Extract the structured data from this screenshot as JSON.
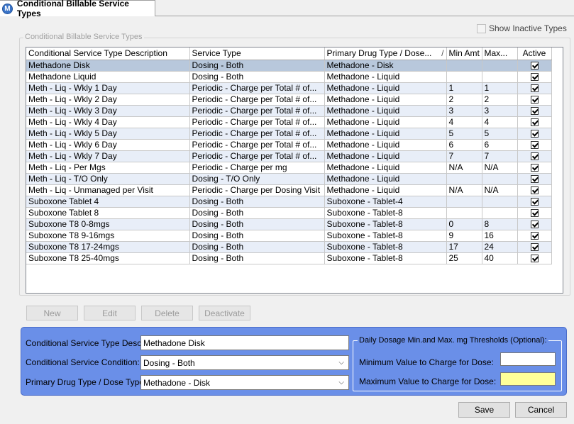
{
  "tab": {
    "icon": "app-logo-icon",
    "icon_glyph": "M",
    "title": "Conditional Billable Service Types"
  },
  "group": {
    "title": "Conditional Billable Service Types"
  },
  "show_inactive": {
    "label": "Show Inactive Types",
    "checked": false
  },
  "grid": {
    "columns": [
      "Conditional Service Type Description",
      "Service Type",
      "Primary Drug Type / Dose...",
      "Min Amt",
      "Max...",
      "Active"
    ],
    "sort_indicator": "/",
    "rows": [
      {
        "desc": "Methadone Disk",
        "service": "Dosing - Both",
        "drug": "Methadone - Disk",
        "min": "",
        "max": "",
        "active": true
      },
      {
        "desc": "Methadone Liquid",
        "service": "Dosing - Both",
        "drug": "Methadone - Liquid",
        "min": "",
        "max": "",
        "active": true
      },
      {
        "desc": "Meth - Liq - Wkly 1 Day",
        "service": "Periodic - Charge per Total # of...",
        "drug": "Methadone - Liquid",
        "min": "1",
        "max": "1",
        "active": true
      },
      {
        "desc": "Meth - Liq - Wkly 2 Day",
        "service": "Periodic - Charge per Total # of...",
        "drug": "Methadone - Liquid",
        "min": "2",
        "max": "2",
        "active": true
      },
      {
        "desc": "Meth - Liq - Wkly 3 Day",
        "service": "Periodic - Charge per Total # of...",
        "drug": "Methadone - Liquid",
        "min": "3",
        "max": "3",
        "active": true
      },
      {
        "desc": "Meth - Liq - Wkly 4 Day",
        "service": "Periodic - Charge per Total # of...",
        "drug": "Methadone - Liquid",
        "min": "4",
        "max": "4",
        "active": true
      },
      {
        "desc": "Meth - Liq - Wkly 5 Day",
        "service": "Periodic - Charge per Total # of...",
        "drug": "Methadone - Liquid",
        "min": "5",
        "max": "5",
        "active": true
      },
      {
        "desc": "Meth - Liq - Wkly 6 Day",
        "service": "Periodic - Charge per Total # of...",
        "drug": "Methadone - Liquid",
        "min": "6",
        "max": "6",
        "active": true
      },
      {
        "desc": "Meth - Liq - Wkly 7 Day",
        "service": "Periodic - Charge per Total # of...",
        "drug": "Methadone - Liquid",
        "min": "7",
        "max": "7",
        "active": true
      },
      {
        "desc": "Meth - Liq - Per Mgs",
        "service": "Periodic - Charge per mg",
        "drug": "Methadone - Liquid",
        "min": "N/A",
        "max": "N/A",
        "active": true
      },
      {
        "desc": "Meth - Liq - T/O Only",
        "service": "Dosing - T/O Only",
        "drug": "Methadone - Liquid",
        "min": "",
        "max": "",
        "active": true
      },
      {
        "desc": "Meth - Liq - Unmanaged per Visit",
        "service": "Periodic - Charge per Dosing Visit",
        "drug": "Methadone - Liquid",
        "min": "N/A",
        "max": "N/A",
        "active": true
      },
      {
        "desc": "Suboxone Tablet 4",
        "service": "Dosing - Both",
        "drug": "Suboxone - Tablet-4",
        "min": "",
        "max": "",
        "active": true
      },
      {
        "desc": "Suboxone Tablet 8",
        "service": "Dosing - Both",
        "drug": "Suboxone - Tablet-8",
        "min": "",
        "max": "",
        "active": true
      },
      {
        "desc": "Suboxone T8 0-8mgs",
        "service": "Dosing - Both",
        "drug": "Suboxone - Tablet-8",
        "min": "0",
        "max": "8",
        "active": true
      },
      {
        "desc": "Suboxone T8 9-16mgs",
        "service": "Dosing - Both",
        "drug": "Suboxone - Tablet-8",
        "min": "9",
        "max": "16",
        "active": true
      },
      {
        "desc": "Suboxone T8 17-24mgs",
        "service": "Dosing - Both",
        "drug": "Suboxone - Tablet-8",
        "min": "17",
        "max": "24",
        "active": true
      },
      {
        "desc": "Suboxone T8 25-40mgs",
        "service": "Dosing - Both",
        "drug": "Suboxone - Tablet-8",
        "min": "25",
        "max": "40",
        "active": true
      }
    ],
    "selected_row": 0
  },
  "actions": {
    "new": "New",
    "edit": "Edit",
    "delete": "Delete",
    "deactivate": "Deactivate"
  },
  "form": {
    "desc_label": "Conditional Service Type Desc:",
    "desc_value": "Methadone Disk",
    "condition_label": "Conditional Service Condition:",
    "condition_value": "Dosing - Both",
    "drug_label": "Primary Drug Type / Dose Type:",
    "drug_value": "Methadone - Disk",
    "thresholds_title": "Daily Dosage Min.and Max. mg Thresholds (Optional):",
    "min_label": "Minimum Value to Charge for Dose:",
    "min_value": "",
    "max_label": "Maximum Value to Charge for Dose:",
    "max_value": "",
    "panel_color": "#6a8fe8",
    "focus_color": "#ffff99"
  },
  "footer": {
    "save": "Save",
    "cancel": "Cancel"
  }
}
